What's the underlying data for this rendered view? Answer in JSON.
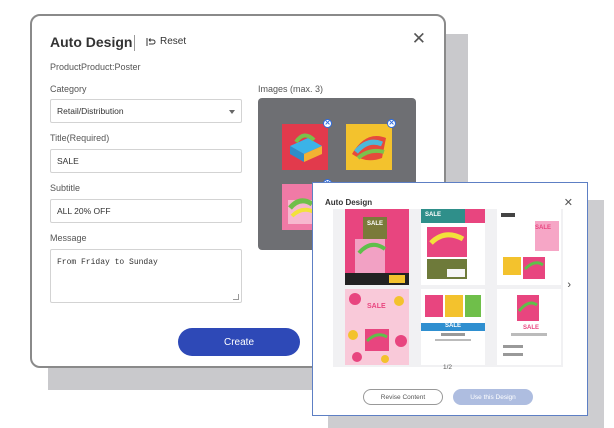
{
  "main_dialog": {
    "title": "Auto Design",
    "reset_label": "Reset",
    "close_glyph": "✕",
    "product_line": "ProductProduct:Poster",
    "category_label": "Category",
    "category_value": "Retail/Distribution",
    "title_label": "Title(Required)",
    "title_value": "SALE",
    "subtitle_label": "Subtitle",
    "subtitle_value": "ALL 20% OFF",
    "message_label": "Message",
    "message_value": "From Friday to Sunday",
    "images_label": "Images (max. 3)",
    "image_remove_glyph": "✕",
    "create_label": "Create"
  },
  "design_dialog": {
    "title": "Auto Design",
    "close_glyph": "✕",
    "next_glyph": "›",
    "pager": "1/2",
    "revise_label": "Revise Content",
    "use_label": "Use this Design",
    "card_texts": {
      "c1_sale": "SALE",
      "c2_sale": "SALE",
      "c3_sale": "SALE",
      "c4_sale": "SALE",
      "c5_sale": "SALE",
      "c6_sale": "SALE"
    }
  },
  "colors": {
    "primary_button": "#2e49b7",
    "disabled_button": "#aebde0",
    "image_panel": "#6e6f73",
    "accent_pink": "#e8457f",
    "dialog_border": "#5d7fc4"
  }
}
